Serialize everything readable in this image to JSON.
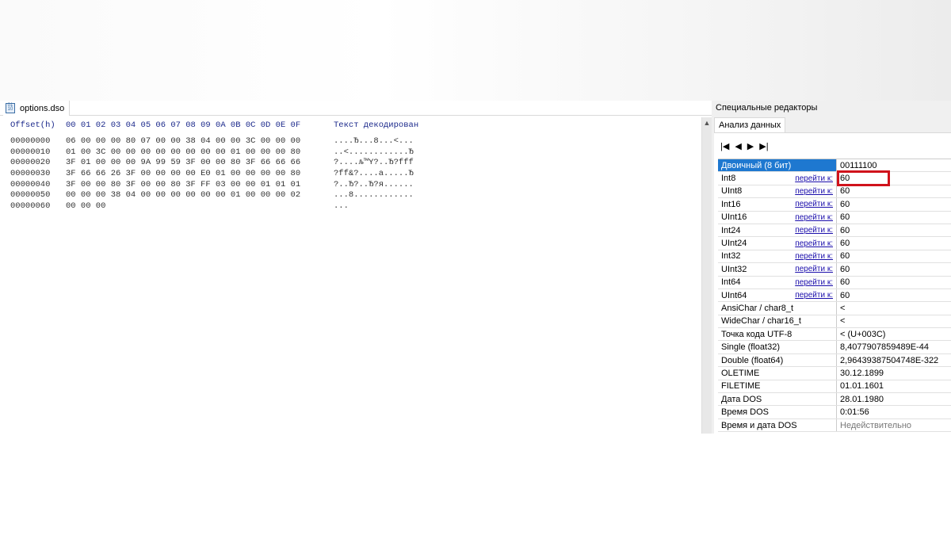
{
  "file_tab": {
    "name": "options.dso"
  },
  "hex": {
    "header_offset": "Offset(h)",
    "header_bytes": "00 01 02 03 04 05 06 07 08 09 0A 0B 0C 0D 0E 0F",
    "header_text": "Текст декодирован",
    "rows": [
      {
        "offset": "00000000",
        "bytes": "06 00 00 00 80 07 00 00 38 04 00 00 3C 00 00 00",
        "text": "....Ђ...8...<..."
      },
      {
        "offset": "00000010",
        "bytes": "01 00 3C 00 00 00 00 00 00 00 00 01 00 00 00 80",
        "text": "..<............Ђ"
      },
      {
        "offset": "00000020",
        "bytes": "3F 01 00 00 00 9A 99 59 3F 00 00 80 3F 66 66 66",
        "text": "?....љ™Y?..Ђ?fff"
      },
      {
        "offset": "00000030",
        "bytes": "3F 66 66 26 3F 00 00 00 00 E0 01 00 00 00 00 80",
        "text": "?ff&?....а.....Ђ"
      },
      {
        "offset": "00000040",
        "bytes": "3F 00 00 80 3F 00 00 80 3F FF 03 00 00 01 01 01",
        "text": "?..Ђ?..Ђ?я......"
      },
      {
        "offset": "00000050",
        "bytes": "00 00 00 38 04 00 00 00 00 00 00 01 00 00 00 02",
        "text": "...8............"
      },
      {
        "offset": "00000060",
        "bytes": "00 00 00",
        "text": "..."
      }
    ]
  },
  "panel": {
    "title": "Специальные редакторы",
    "tab": "Анализ данных",
    "nav": [
      "first",
      "prev",
      "next",
      "last"
    ],
    "goto_label": "перейти к:",
    "rows": [
      {
        "label": "Двоичный (8 бит)",
        "value": "00111100",
        "selected": true
      },
      {
        "label": "Int8",
        "value": "60",
        "link": true,
        "highlight": true
      },
      {
        "label": "UInt8",
        "value": "60",
        "link": true
      },
      {
        "label": "Int16",
        "value": "60",
        "link": true
      },
      {
        "label": "UInt16",
        "value": "60",
        "link": true
      },
      {
        "label": "Int24",
        "value": "60",
        "link": true
      },
      {
        "label": "UInt24",
        "value": "60",
        "link": true
      },
      {
        "label": "Int32",
        "value": "60",
        "link": true
      },
      {
        "label": "UInt32",
        "value": "60",
        "link": true
      },
      {
        "label": "Int64",
        "value": "60",
        "link": true
      },
      {
        "label": "UInt64",
        "value": "60",
        "link": true
      },
      {
        "label": "AnsiChar / char8_t",
        "value": "<"
      },
      {
        "label": "WideChar / char16_t",
        "value": "<"
      },
      {
        "label": "Точка кода UTF-8",
        "value": "< (U+003C)"
      },
      {
        "label": "Single (float32)",
        "value": "8,4077907859489E-44"
      },
      {
        "label": "Double (float64)",
        "value": "2,96439387504748E-322"
      },
      {
        "label": "OLETIME",
        "value": "30.12.1899"
      },
      {
        "label": "FILETIME",
        "value": "01.01.1601"
      },
      {
        "label": "Дата DOS",
        "value": "28.01.1980"
      },
      {
        "label": "Время DOS",
        "value": "0:01:56"
      },
      {
        "label": "Время и дата DOS",
        "value": "Недействительно",
        "grey": true
      }
    ]
  },
  "colors": {
    "selected": "#1e78d0",
    "highlight": "#d0121b",
    "hex_header": "#1c2a8c"
  }
}
